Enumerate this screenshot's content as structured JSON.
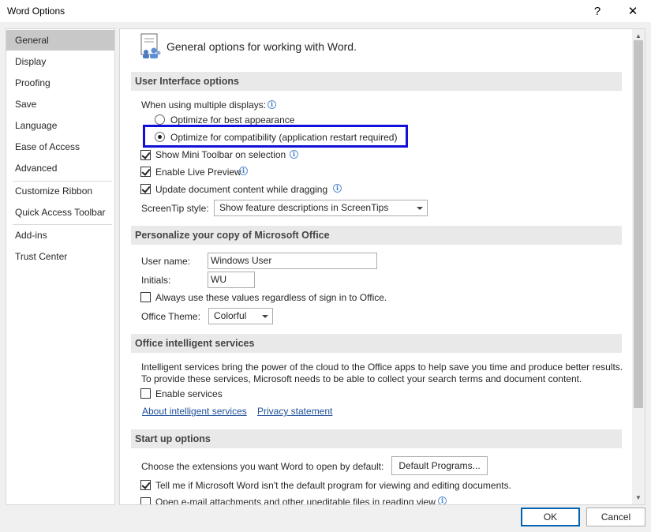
{
  "window": {
    "title": "Word Options",
    "help_symbol": "?",
    "close_symbol": "✕"
  },
  "nav": {
    "items": [
      {
        "label": "General",
        "selected": true
      },
      {
        "label": "Display"
      },
      {
        "label": "Proofing"
      },
      {
        "label": "Save"
      },
      {
        "label": "Language"
      },
      {
        "label": "Ease of Access"
      },
      {
        "label": "Advanced"
      },
      {
        "label": "Customize Ribbon"
      },
      {
        "label": "Quick Access Toolbar"
      },
      {
        "label": "Add-ins"
      },
      {
        "label": "Trust Center"
      }
    ]
  },
  "main": {
    "page_title": "General options for working with Word.",
    "ui_options": {
      "header": "User Interface options",
      "multiple_displays_label": "When using multiple displays:",
      "radio_best_appearance": "Optimize for best appearance",
      "radio_compatibility": "Optimize for compatibility (application restart required)",
      "mini_toolbar": "Show Mini Toolbar on selection",
      "live_preview": "Enable Live Preview",
      "update_dragging": "Update document content while dragging",
      "screentip_label": "ScreenTip style:",
      "screentip_value": "Show feature descriptions in ScreenTips"
    },
    "personalize": {
      "header": "Personalize your copy of Microsoft Office",
      "username_label": "User name:",
      "username_value": "Windows User",
      "initials_label": "Initials:",
      "initials_value": "WU",
      "always_use": "Always use these values regardless of sign in to Office.",
      "theme_label": "Office Theme:",
      "theme_value": "Colorful"
    },
    "intelligent": {
      "header": "Office intelligent services",
      "desc_line1": "Intelligent services bring the power of the cloud to the Office apps to help save you time and produce better results.",
      "desc_line2": "To provide these services, Microsoft needs to be able to collect your search terms and document content.",
      "enable_services": "Enable services",
      "about_link": "About intelligent services",
      "privacy_link": "Privacy statement"
    },
    "startup": {
      "header": "Start up options",
      "extensions_label": "Choose the extensions you want Word to open by default:",
      "default_programs_button": "Default Programs...",
      "tell_me": "Tell me if Microsoft Word isn't the default program for viewing and editing documents.",
      "open_email": "Open e-mail attachments and other uneditable files in reading view"
    }
  },
  "footer": {
    "ok_label": "OK",
    "cancel_label": "Cancel"
  },
  "colors": {
    "highlight_box": "#1010d8",
    "link": "#1c4e99",
    "ok_border": "#0063b1"
  }
}
